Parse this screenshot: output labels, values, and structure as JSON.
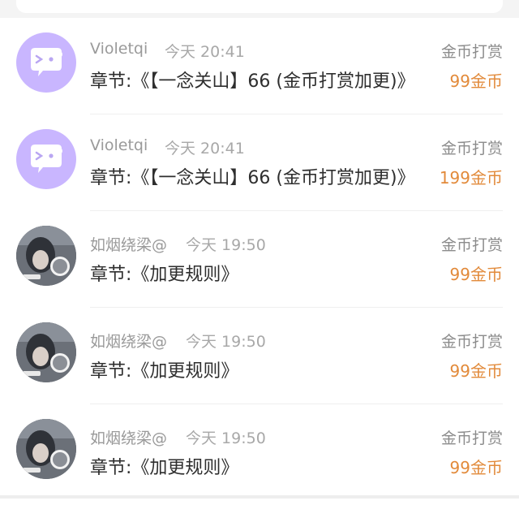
{
  "transactions": [
    {
      "avatar": "purple-chat-bubble-avatar",
      "user": "Violetqi",
      "time": "今天 20:41",
      "type": "金币打赏",
      "chapter": "章节:《【一念关山】66 (金币打赏加更)》",
      "amount": "99金币"
    },
    {
      "avatar": "purple-chat-bubble-avatar",
      "user": "Violetqi",
      "time": "今天 20:41",
      "type": "金币打赏",
      "chapter": "章节:《【一念关山】66 (金币打赏加更)》",
      "amount": "199金币"
    },
    {
      "avatar": "photo-avatar",
      "user": "如烟绕梁@",
      "time": "今天 19:50",
      "type": "金币打赏",
      "chapter": "章节:《加更规则》",
      "amount": "99金币"
    },
    {
      "avatar": "photo-avatar",
      "user": "如烟绕梁@",
      "time": "今天 19:50",
      "type": "金币打赏",
      "chapter": "章节:《加更规则》",
      "amount": "99金币"
    },
    {
      "avatar": "photo-avatar",
      "user": "如烟绕梁@",
      "time": "今天 19:50",
      "type": "金币打赏",
      "chapter": "章节:《加更规则》",
      "amount": "99金币"
    }
  ],
  "colors": {
    "amount": "#e28a3a",
    "avatar_purple": "#c9b6ff",
    "text": "#2e2e2e",
    "meta": "#9a9a9a"
  }
}
